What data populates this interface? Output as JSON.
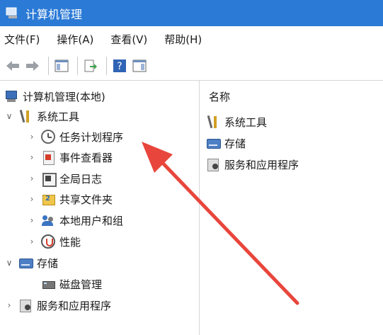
{
  "window": {
    "title": "计算机管理"
  },
  "menu": [
    "文件(F)",
    "操作(A)",
    "查看(V)",
    "帮助(H)"
  ],
  "toolbar": {
    "buttons": [
      "back-arrow-icon",
      "forward-arrow-icon",
      "show-hide-tree-icon",
      "export-list-icon",
      "help-icon",
      "show-hide-action-pane-icon"
    ]
  },
  "tree": {
    "root": "计算机管理(本地)",
    "system_tools": "系统工具",
    "task_scheduler": "任务计划程序",
    "event_viewer": "事件查看器",
    "global_log": "全局日志",
    "shared_folders": "共享文件夹",
    "local_users": "本地用户和组",
    "performance": "性能",
    "storage": "存储",
    "disk_management": "磁盘管理",
    "services_apps": "服务和应用程序"
  },
  "list": {
    "header": "名称",
    "items": [
      "系统工具",
      "存储",
      "服务和应用程序"
    ]
  },
  "colors": {
    "titlebar": "#2b7ad6",
    "arrow": "#e8463c"
  }
}
